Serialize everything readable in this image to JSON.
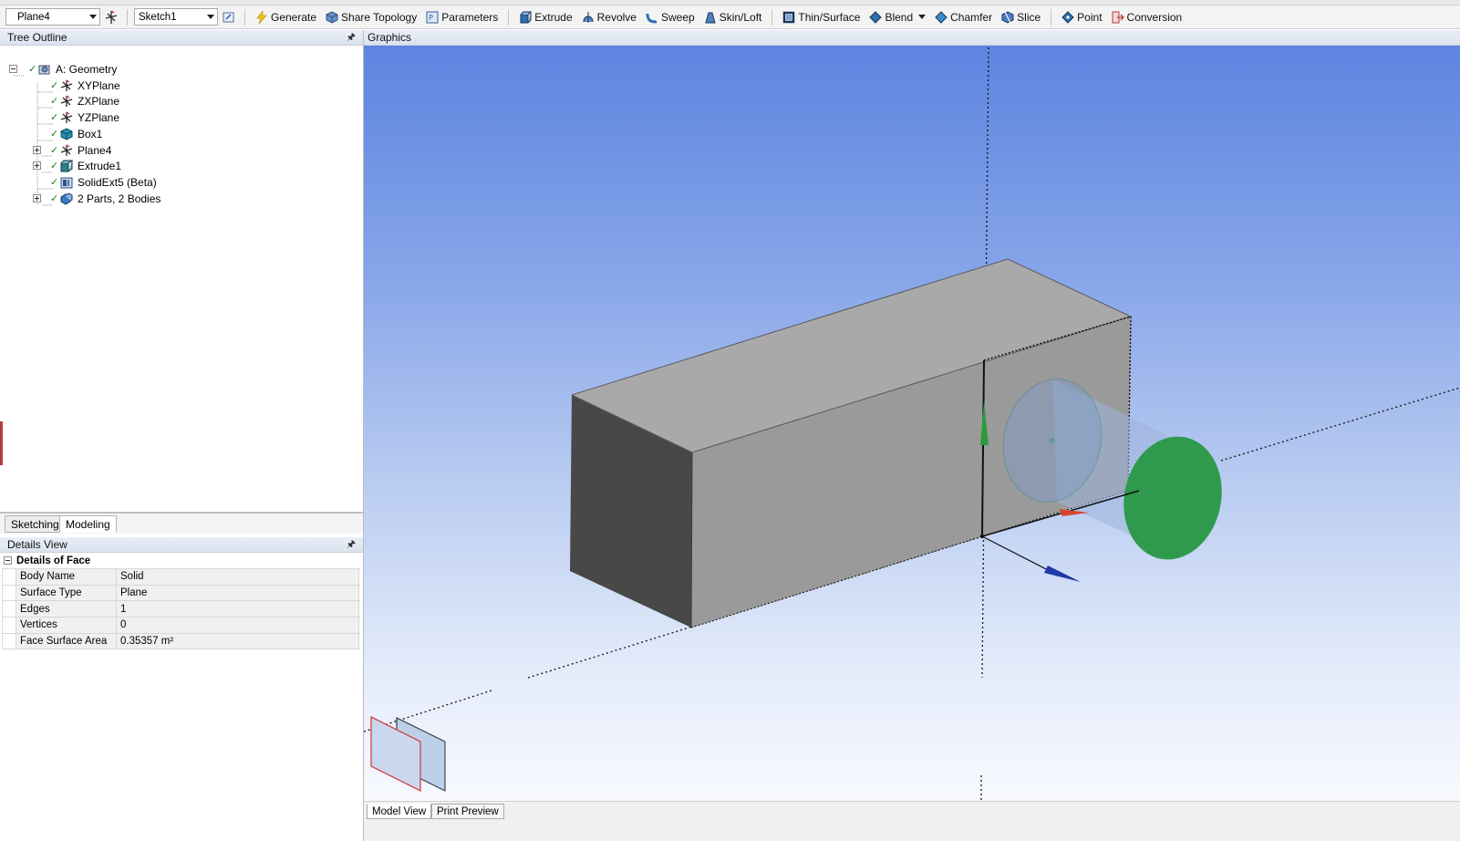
{
  "toolbar": {
    "plane_select": "Plane4",
    "sketch_select": "Sketch1",
    "buttons": {
      "generate": "Generate",
      "share_topology": "Share Topology",
      "parameters": "Parameters",
      "extrude": "Extrude",
      "revolve": "Revolve",
      "sweep": "Sweep",
      "skin_loft": "Skin/Loft",
      "thin_surface": "Thin/Surface",
      "blend": "Blend",
      "chamfer": "Chamfer",
      "slice": "Slice",
      "point": "Point",
      "conversion": "Conversion"
    }
  },
  "tree_outline": {
    "title": "Tree Outline",
    "root": "A: Geometry",
    "items": [
      "XYPlane",
      "ZXPlane",
      "YZPlane",
      "Box1",
      "Plane4",
      "Extrude1",
      "SolidExt5 (Beta)",
      "2 Parts, 2 Bodies"
    ]
  },
  "mode_tabs": [
    "Sketching",
    "Modeling"
  ],
  "details_view": {
    "title": "Details View",
    "group": "Details of Face",
    "rows": [
      {
        "key": "Body Name",
        "value": "Solid"
      },
      {
        "key": "Surface Type",
        "value": "Plane"
      },
      {
        "key": "Edges",
        "value": "1"
      },
      {
        "key": "Vertices",
        "value": "0"
      },
      {
        "key": "Face Surface Area",
        "value": "0.35357 m²"
      }
    ]
  },
  "graphics": {
    "title": "Graphics",
    "bottom_tabs": [
      "Model View",
      "Print Preview"
    ]
  },
  "colors": {
    "box_front": "#484848",
    "box_side": "#9a9a9a",
    "box_top": "#a8a8a8",
    "selected_face": "#2f9a4d",
    "axis_x": "#d8452c",
    "axis_y": "#2b9a3a",
    "axis_z": "#1d3aa8"
  }
}
